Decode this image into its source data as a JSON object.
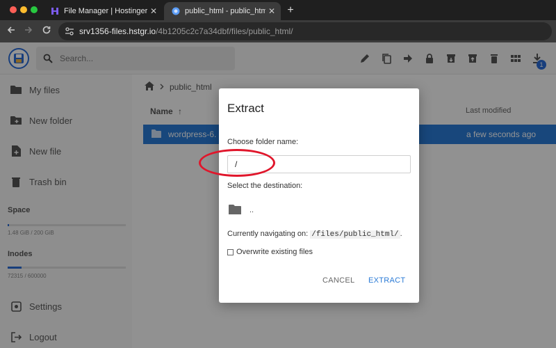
{
  "browser": {
    "tabs": [
      {
        "label": "File Manager | Hostinger",
        "close": "✕"
      },
      {
        "label": "public_html - public_html - p",
        "close": "✕"
      }
    ],
    "new_tab": "+",
    "url_host": "srv1356-files.hstgr.io",
    "url_path": "/4b1205c2c7a34dbf/files/public_html/"
  },
  "header": {
    "search_placeholder": "Search...",
    "download_badge": "1"
  },
  "sidebar": {
    "items": [
      {
        "label": "My files",
        "icon": "folder-icon"
      },
      {
        "label": "New folder",
        "icon": "create-folder-icon"
      },
      {
        "label": "New file",
        "icon": "note-add-icon"
      },
      {
        "label": "Trash bin",
        "icon": "trash-icon"
      },
      {
        "label": "Settings",
        "icon": "settings-icon"
      },
      {
        "label": "Logout",
        "icon": "logout-icon"
      }
    ],
    "space": {
      "label": "Space",
      "info": "1.48 GiB / 200 GiB",
      "fraction": 0.0074
    },
    "inodes": {
      "label": "Inodes",
      "info": "72315 / 600000",
      "fraction": 0.12
    }
  },
  "main": {
    "breadcrumb": "public_html",
    "columns": {
      "name": "Name",
      "sort_arrow": "↑",
      "modified": "Last modified"
    },
    "file": {
      "name": "wordpress-6.",
      "modified": "a few seconds ago"
    }
  },
  "dialog": {
    "title": "Extract",
    "folder_label": "Choose folder name:",
    "folder_value": "/",
    "destination_label": "Select the destination:",
    "parent_folder": "..",
    "navigating_prefix": "Currently navigating on: ",
    "navigating_path": "/files/public_html/",
    "navigating_suffix": ".",
    "overwrite_label": "Overwrite existing files",
    "overwrite_checked": false,
    "cancel": "CANCEL",
    "extract": "EXTRACT"
  },
  "colors": {
    "accent": "#2a7ad6",
    "highlight_ring": "#e0162b"
  }
}
